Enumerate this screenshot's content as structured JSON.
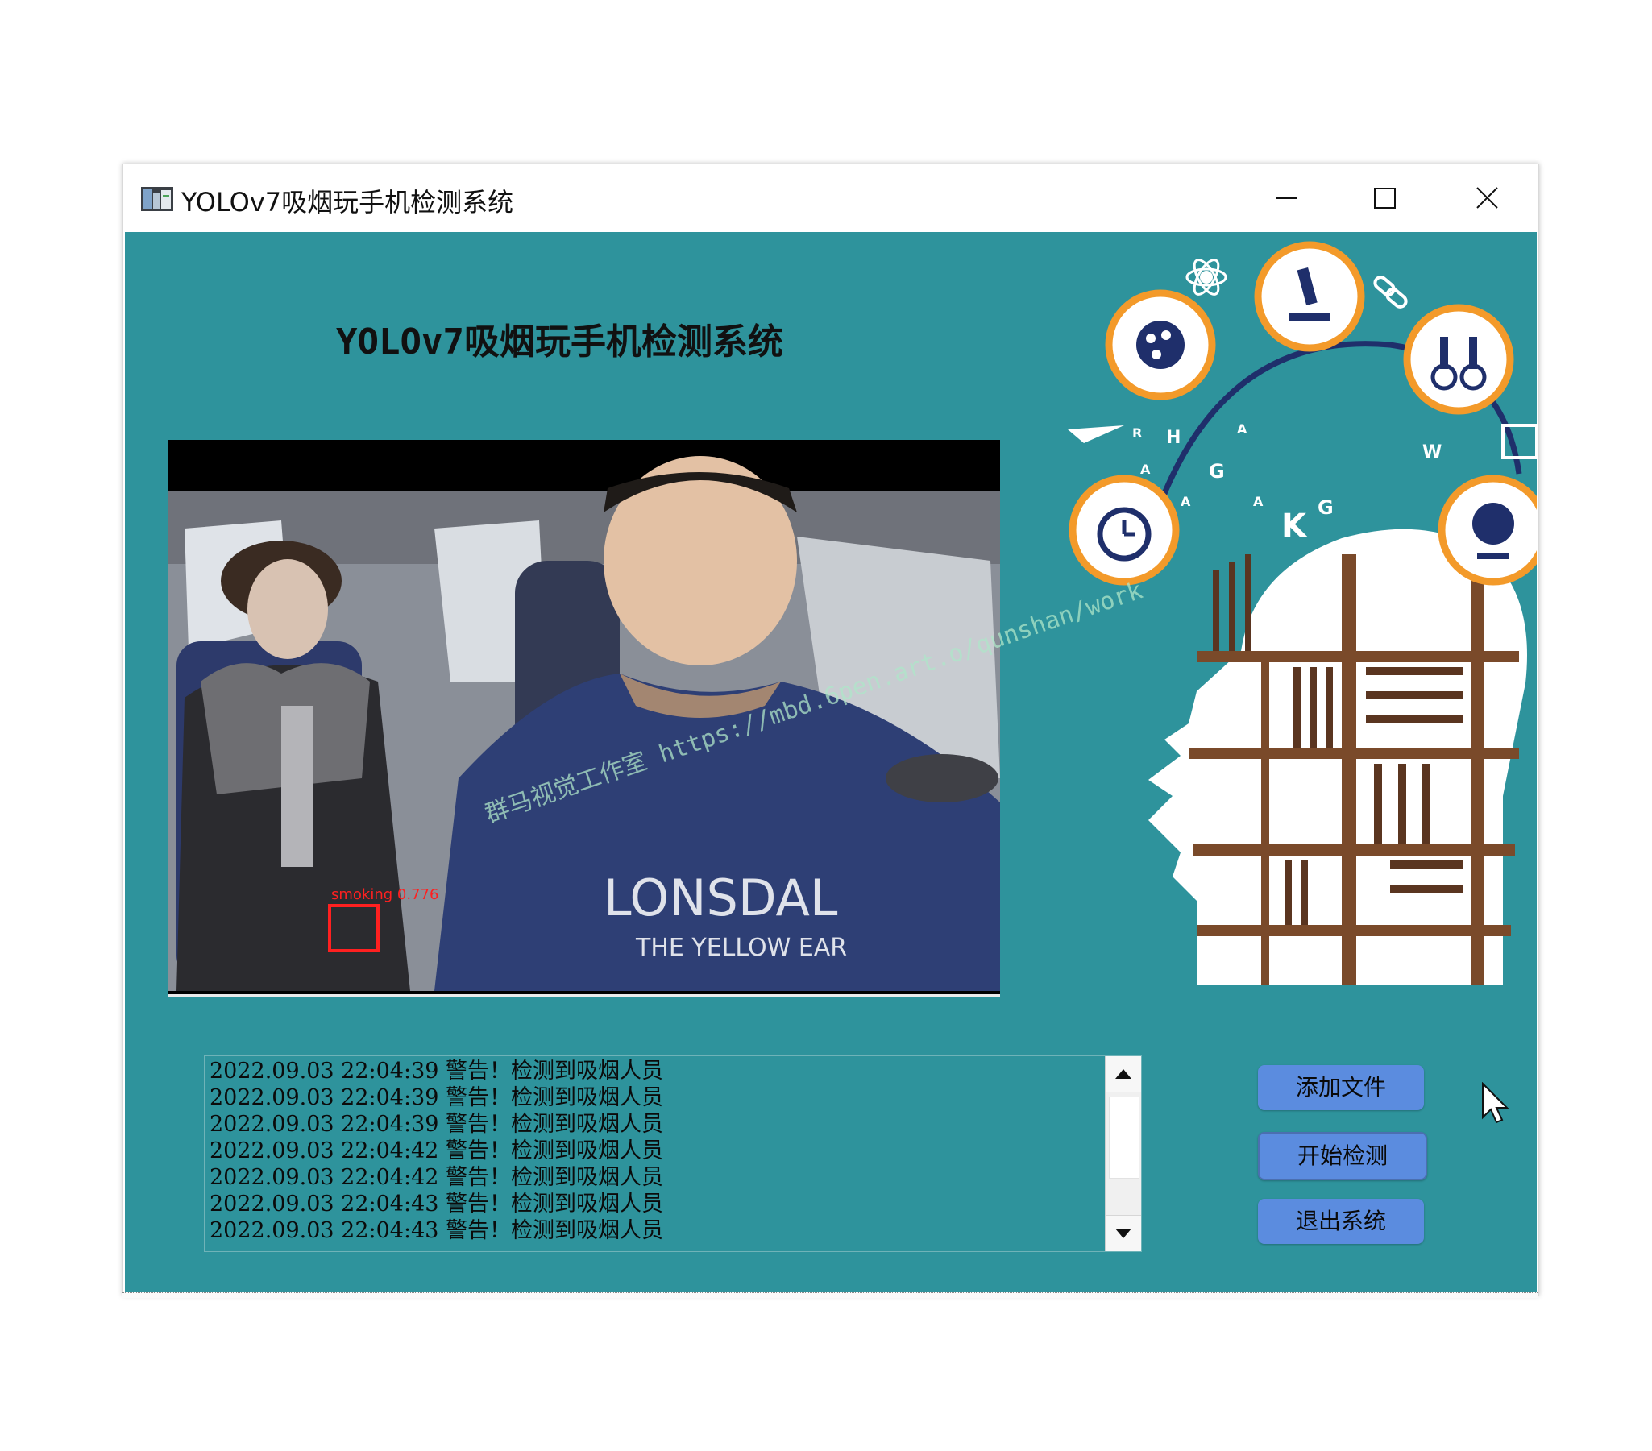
{
  "window": {
    "title": "YOLOv7吸烟玩手机检测系统",
    "controls": {
      "minimize": "minimize",
      "maximize": "maximize",
      "close": "close"
    }
  },
  "main": {
    "heading": "YOLOv7吸烟玩手机检测系统",
    "video": {
      "detection_label": "smoking 0.776",
      "shirt_text_line1": "LONSDAL",
      "shirt_text_line2": "THE YELLOW EAR",
      "box_color": "#ff2020"
    },
    "watermark": "群马视觉工作室 https://mbd.6pen.art.o/qunshan/work"
  },
  "decoration": {
    "letters": [
      "A",
      "H",
      "A",
      "G",
      "A",
      "K",
      "G",
      "W",
      "R",
      "A"
    ],
    "theme_colors": {
      "ring": "#f39a2a",
      "navy": "#1f2f6b",
      "shelf": "#7a4a2a"
    }
  },
  "log": {
    "lines": [
      "2022.09.03 22:04:39 警告！检测到吸烟人员",
      "2022.09.03 22:04:39 警告！检测到吸烟人员",
      "2022.09.03 22:04:39 警告！检测到吸烟人员",
      "2022.09.03 22:04:42 警告！检测到吸烟人员",
      "2022.09.03 22:04:42 警告！检测到吸烟人员",
      "2022.09.03 22:04:43 警告！检测到吸烟人员",
      "2022.09.03 22:04:43 警告！检测到吸烟人员"
    ]
  },
  "buttons": {
    "add_file": "添加文件",
    "start_detect": "开始检测",
    "exit_system": "退出系统"
  },
  "colors": {
    "panel_bg": "#2e939c",
    "button_bg": "#5b8cdf",
    "window_bg": "#ffffff"
  }
}
